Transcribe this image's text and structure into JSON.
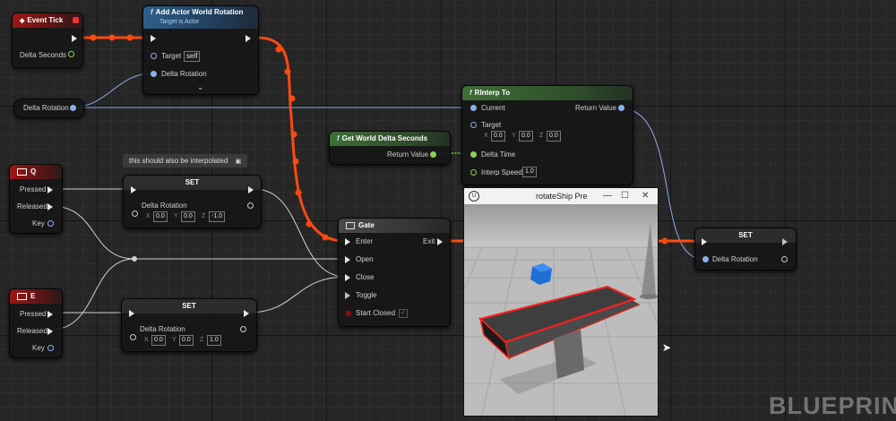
{
  "nodes": {
    "event_tick": {
      "title": "Event Tick",
      "delta_seconds": "Delta Seconds"
    },
    "add_rotation": {
      "title": "Add Actor World Rotation",
      "subtitle": "Target is Actor",
      "target_label": "Target",
      "target_value": "self",
      "delta_label": "Delta Rotation"
    },
    "delta_var": {
      "label": "Delta Rotation"
    },
    "rinterp": {
      "title": "RInterp To",
      "current": "Current",
      "target": "Target",
      "tx": "0.0",
      "ty": "0.0",
      "tz": "0.0",
      "delta_time": "Delta Time",
      "interp_speed": "Interp Speed",
      "speed_value": "1.0",
      "return_value": "Return Value"
    },
    "get_delta": {
      "title": "Get World Delta Seconds",
      "return_value": "Return Value"
    },
    "comment": {
      "text": "this should also be interpolated"
    },
    "q_key": {
      "title": "Q",
      "pressed": "Pressed",
      "released": "Released",
      "key": "Key"
    },
    "e_key": {
      "title": "E",
      "pressed": "Pressed",
      "released": "Released",
      "key": "Key"
    },
    "set_q": {
      "title": "SET",
      "label": "Delta Rotation",
      "x": "0.0",
      "y": "0.0",
      "z": "-1.0"
    },
    "set_e": {
      "title": "SET",
      "label": "Delta Rotation",
      "x": "0.0",
      "y": "0.0",
      "z": "1.0"
    },
    "gate": {
      "title": "Gate",
      "enter": "Enter",
      "exit": "Exit",
      "open": "Open",
      "close": "Close",
      "toggle": "Toggle",
      "start_closed": "Start Closed"
    },
    "set_right": {
      "title": "SET",
      "label": "Delta Rotation"
    }
  },
  "axes": {
    "x": "X",
    "y": "Y",
    "z": "Z"
  },
  "viewport": {
    "title": "rotateShip Pre",
    "minimize": "—",
    "maximize": "☐",
    "close": "✕"
  },
  "watermark": "BLUEPRIN",
  "colors": {
    "exec_wire": "#ff4a12",
    "data_wire": "#aab8d8",
    "float_wire": "#8ecf5a"
  }
}
